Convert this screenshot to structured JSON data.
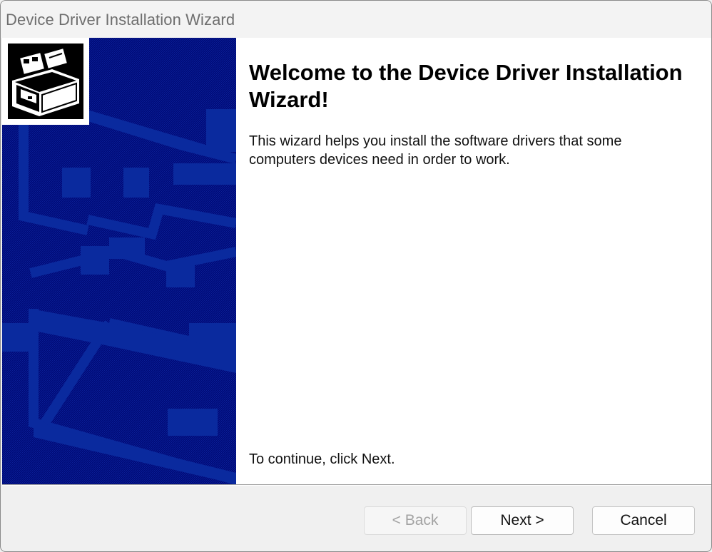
{
  "window": {
    "title": "Device Driver Installation Wizard"
  },
  "main": {
    "heading": "Welcome to the Device Driver Installation Wizard!",
    "intro": "This wizard helps you install the software drivers that some computers devices need in order to work.",
    "continue_hint": "To continue, click Next."
  },
  "buttons": {
    "back_label": "< Back",
    "back_enabled": false,
    "next_label": "Next >",
    "cancel_label": "Cancel"
  },
  "colors": {
    "side_panel": "#000c7a",
    "side_panel_art": "#0a2a9e",
    "content_bg": "#ffffff",
    "frame_bg": "#f0f0f0"
  },
  "icons": {
    "banner_art": "computer-hardware-banner",
    "wizard_icon": "device-install-icon"
  }
}
